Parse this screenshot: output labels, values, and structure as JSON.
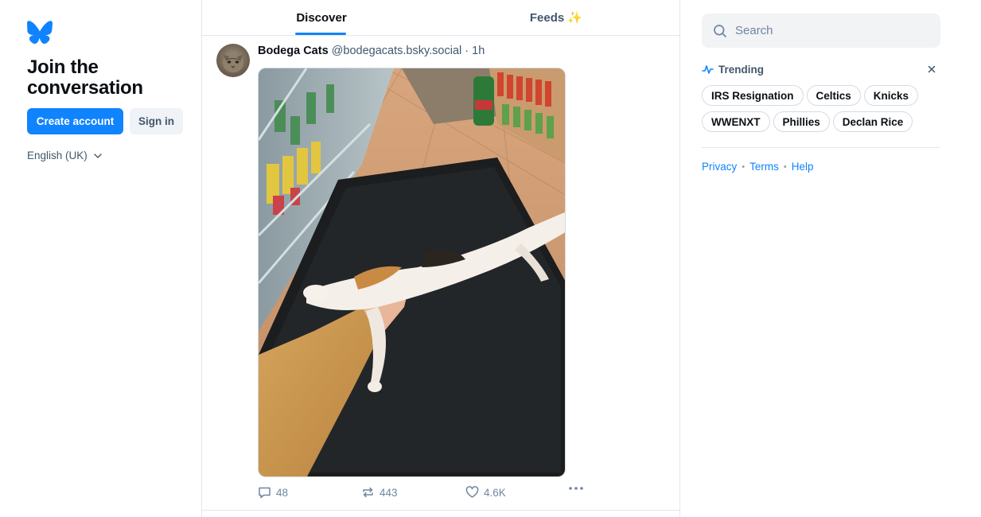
{
  "brand": {
    "logo_icon": "butterfly-icon",
    "accent": "#1083fe"
  },
  "left": {
    "heading": "Join the conversation",
    "create_account": "Create account",
    "sign_in": "Sign in",
    "language": "English (UK)"
  },
  "tabs": [
    {
      "label": "Discover",
      "active": true
    },
    {
      "label": "Feeds ✨",
      "active": false
    }
  ],
  "post": {
    "author": "Bodega Cats",
    "handle": "@bodegacats.bsky.social",
    "time": "· 1h",
    "image_alt": "cat-stretched-on-bodega-mat",
    "replies": "48",
    "reposts": "443",
    "likes": "4.6K"
  },
  "search": {
    "placeholder": "Search"
  },
  "trending": {
    "title": "Trending",
    "items": [
      "IRS Resignation",
      "Celtics",
      "Knicks",
      "WWENXT",
      "Phillies",
      "Declan Rice"
    ]
  },
  "footer": {
    "privacy": "Privacy",
    "terms": "Terms",
    "help": "Help"
  }
}
